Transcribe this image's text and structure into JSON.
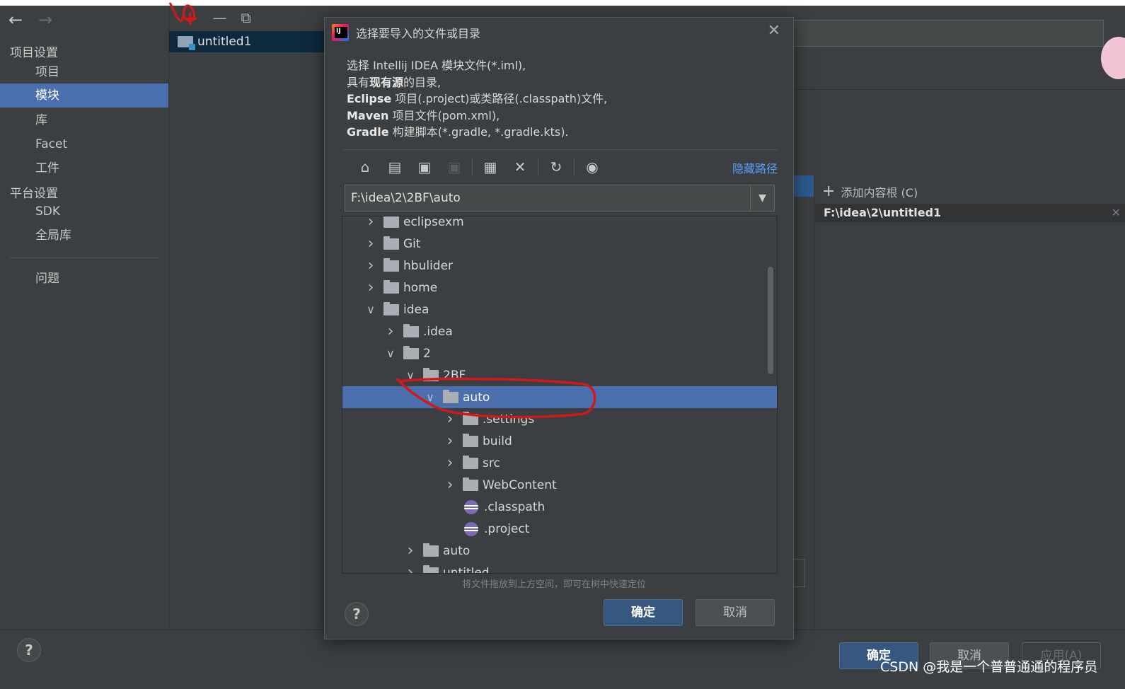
{
  "nav": {
    "back_icon": "arrow-left-icon",
    "forward_icon": "arrow-right-icon",
    "project_settings": "项目设置",
    "items_project": [
      "项目",
      "模块",
      "库",
      "Facet",
      "工件"
    ],
    "platform_settings": "平台设置",
    "items_platform": [
      "SDK",
      "全局库"
    ],
    "problems": "问题",
    "selected": "模块"
  },
  "modules": {
    "toolbar": [
      "add-icon",
      "remove-icon",
      "copy-icon"
    ],
    "items": [
      "untitled1"
    ]
  },
  "content_roots": {
    "add_label": "添加内容根 (C)",
    "root_path": "F:\\idea\\2\\untitled1"
  },
  "dialog": {
    "title": "选择要导入的文件或目录",
    "desc": {
      "l1": "选择 Intellij IDEA 模块文件(*.iml),",
      "l2_a": "具有",
      "l2_b": "现有源",
      "l2_c": "的目录,",
      "l3_a": "Eclipse",
      "l3_b": " 项目(.project)或类路径(.classpath)文件,",
      "l4_a": "Maven",
      "l4_b": " 项目文件(pom.xml),",
      "l5_a": "Gradle",
      "l5_b": " 构建脚本(*.gradle, *.gradle.kts)."
    },
    "toolbar_icons": [
      "home-icon",
      "desktop-icon",
      "project-folder-icon",
      "module-folder-icon",
      "new-folder-icon",
      "delete-icon",
      "refresh-icon",
      "show-hidden-icon"
    ],
    "hide_path": "隐藏路径",
    "path": "F:\\idea\\2\\2BF\\auto",
    "tree": [
      {
        "label": "eclipsexm",
        "depth": 0,
        "expanded": false,
        "type": "folder"
      },
      {
        "label": "Git",
        "depth": 0,
        "expanded": false,
        "type": "folder"
      },
      {
        "label": "hbulider",
        "depth": 0,
        "expanded": false,
        "type": "folder"
      },
      {
        "label": "home",
        "depth": 0,
        "expanded": false,
        "type": "folder"
      },
      {
        "label": "idea",
        "depth": 0,
        "expanded": true,
        "type": "folder"
      },
      {
        "label": ".idea",
        "depth": 1,
        "expanded": false,
        "type": "folder"
      },
      {
        "label": "2",
        "depth": 1,
        "expanded": true,
        "type": "folder"
      },
      {
        "label": "2BF",
        "depth": 2,
        "expanded": true,
        "type": "folder"
      },
      {
        "label": "auto",
        "depth": 3,
        "expanded": true,
        "type": "folder",
        "selected": true
      },
      {
        "label": ".settings",
        "depth": 4,
        "expanded": false,
        "type": "folder"
      },
      {
        "label": "build",
        "depth": 4,
        "expanded": false,
        "type": "folder"
      },
      {
        "label": "src",
        "depth": 4,
        "expanded": false,
        "type": "folder"
      },
      {
        "label": "WebContent",
        "depth": 4,
        "expanded": false,
        "type": "folder"
      },
      {
        "label": ".classpath",
        "depth": 4,
        "type": "eclipse-file"
      },
      {
        "label": ".project",
        "depth": 4,
        "type": "eclipse-file"
      },
      {
        "label": "auto",
        "depth": 2,
        "expanded": false,
        "type": "folder"
      },
      {
        "label": "untitled",
        "depth": 2,
        "expanded": false,
        "type": "folder"
      }
    ],
    "drop_hint": "将文件拖放到上方空间，即可在树中快速定位",
    "ok": "确定",
    "cancel": "取消"
  },
  "footer": {
    "ok": "确定",
    "cancel": "取消",
    "apply": "应用(A)"
  },
  "watermark": "CSDN @我是一个普普通通的程序员",
  "colors": {
    "background": "#3c3f41",
    "selection": "#4b6eaf",
    "link": "#589df6",
    "annotation": "#d01a1a"
  }
}
